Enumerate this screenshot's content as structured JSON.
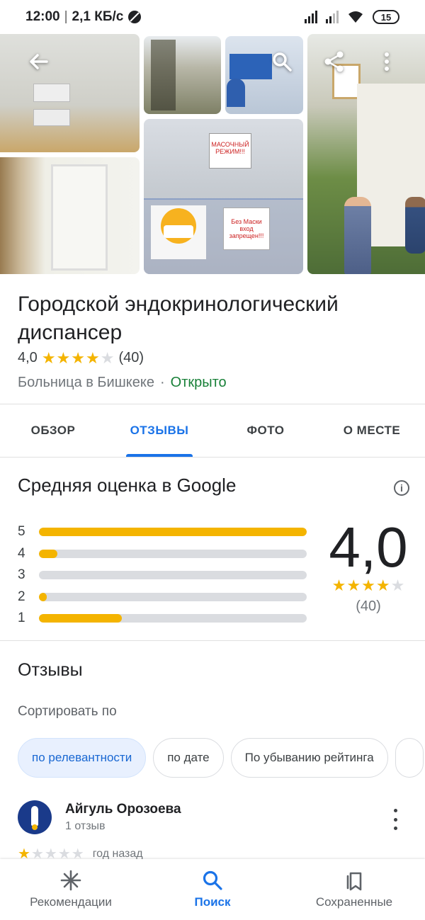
{
  "status_bar": {
    "time": "12:00",
    "separator": "|",
    "speed": "2,1 КБ/с",
    "battery": "15"
  },
  "place": {
    "name": "Городской эндокринологический диспансер",
    "rating": "4,0",
    "rating_value": 4.0,
    "review_count": "(40)",
    "category": "Больница в Бишкеке",
    "dot": "·",
    "status": "Открыто"
  },
  "tabs": [
    {
      "label": "ОБЗОР",
      "active": false
    },
    {
      "label": "ОТЗЫВЫ",
      "active": true
    },
    {
      "label": "ФОТО",
      "active": false
    },
    {
      "label": "О МЕСТЕ",
      "active": false
    }
  ],
  "summary": {
    "title": "Средняя оценка в Google",
    "score": "4,0",
    "count": "(40)",
    "distribution": [
      {
        "stars": "5",
        "fraction": 1.0
      },
      {
        "stars": "4",
        "fraction": 0.07
      },
      {
        "stars": "3",
        "fraction": 0.0
      },
      {
        "stars": "2",
        "fraction": 0.03
      },
      {
        "stars": "1",
        "fraction": 0.31
      }
    ]
  },
  "reviews": {
    "title": "Отзывы",
    "sort_label": "Сортировать по",
    "sort_options": [
      {
        "label": "по релевантности",
        "active": true
      },
      {
        "label": "по дате",
        "active": false
      },
      {
        "label": "По убыванию рейтинга",
        "active": false
      }
    ],
    "items": [
      {
        "author": "Айгуль Орозоева",
        "author_meta": "1 отзыв",
        "stars": 1,
        "when": "год назад"
      }
    ]
  },
  "gallery": {
    "sign1_text": "МАСОЧНЫЙ РЕЖИМ!!!",
    "sign2_text": "Без Маски вход запрещен!!!"
  },
  "bottom_nav": [
    {
      "label": "Рекомендации",
      "icon": "sparkle-icon",
      "active": false
    },
    {
      "label": "Поиск",
      "icon": "search-icon",
      "active": true
    },
    {
      "label": "Сохраненные",
      "icon": "bookmarks-icon",
      "active": false
    }
  ],
  "colors": {
    "accent": "#1a73e8",
    "star": "#f4b400",
    "open": "#188038"
  }
}
